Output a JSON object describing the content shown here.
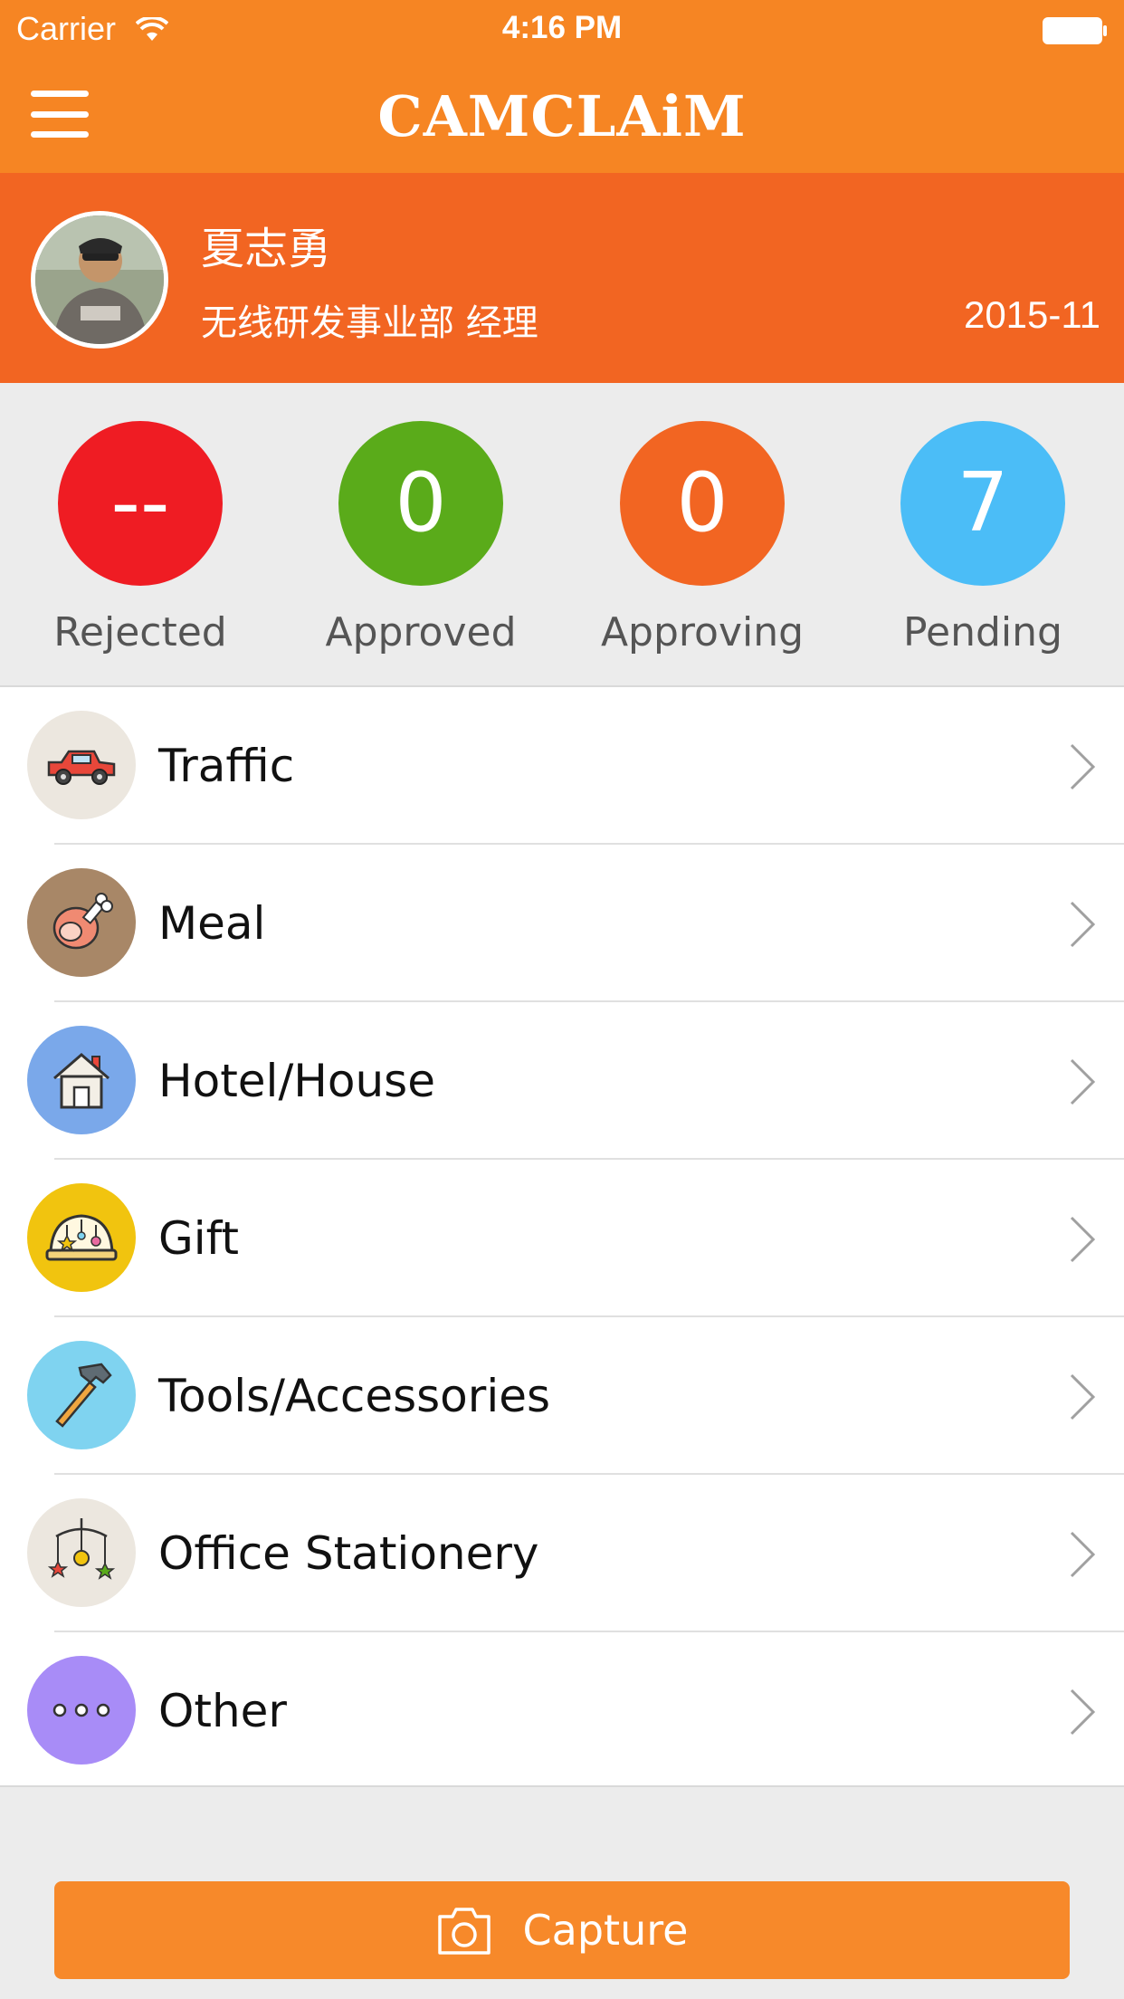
{
  "status_bar": {
    "carrier": "Carrier",
    "time": "4:16 PM"
  },
  "nav": {
    "logo": "CAMCLAiM"
  },
  "profile": {
    "name": "夏志勇",
    "department": "无线研发事业部 经理",
    "period": "2015-11"
  },
  "stats": [
    {
      "label": "Rejected",
      "value": "--",
      "color": "#ef1c23"
    },
    {
      "label": "Approved",
      "value": "0",
      "color": "#5aab1a"
    },
    {
      "label": "Approving",
      "value": "0",
      "color": "#f26522"
    },
    {
      "label": "Pending",
      "value": "7",
      "color": "#4bbdf7"
    }
  ],
  "categories": [
    {
      "label": "Traffic",
      "icon": "car-icon",
      "bg": "#ece7df"
    },
    {
      "label": "Meal",
      "icon": "ham-icon",
      "bg": "#a88767"
    },
    {
      "label": "Hotel/House",
      "icon": "house-icon",
      "bg": "#7aa8ea"
    },
    {
      "label": "Gift",
      "icon": "gift-icon",
      "bg": "#f1c40f"
    },
    {
      "label": "Tools/Accessories",
      "icon": "hammer-icon",
      "bg": "#7fd3f0"
    },
    {
      "label": "Office Stationery",
      "icon": "mobile-icon",
      "bg": "#ece7df"
    },
    {
      "label": "Other",
      "icon": "more-icon",
      "bg": "#a88cf7"
    }
  ],
  "capture": {
    "label": "Capture"
  }
}
